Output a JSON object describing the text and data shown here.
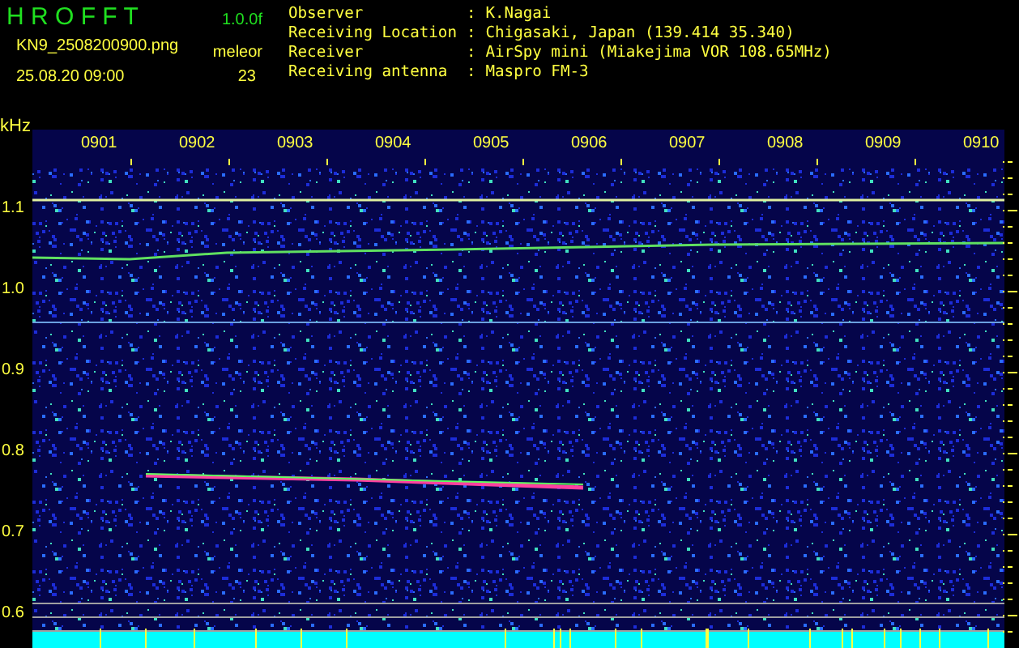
{
  "header": {
    "app_name": "H R O F F T",
    "version": "1.0.0f",
    "filename": "KN9_2508200900.png",
    "datetime": "25.08.20 09:00",
    "count_label": "meleor",
    "count": "23"
  },
  "info_separator": ":",
  "info": [
    {
      "label": "Observer",
      "value": "K.Nagai"
    },
    {
      "label": "Receiving Location",
      "value": "Chigasaki, Japan (139.414 35.340)"
    },
    {
      "label": "Receiver",
      "value": "AirSpy mini (Miakejima VOR 108.65MHz)"
    },
    {
      "label": "Receiving antenna",
      "value": "Maspro FM-3"
    }
  ],
  "plot": {
    "unit": "kHz",
    "x_labels": [
      "0901",
      "0902",
      "0903",
      "0904",
      "0905",
      "0906",
      "0907",
      "0908",
      "0909",
      "0910"
    ],
    "y_labels": [
      "1.1",
      "1.0",
      "0.9",
      "0.8",
      "0.7",
      "0.6"
    ]
  }
}
